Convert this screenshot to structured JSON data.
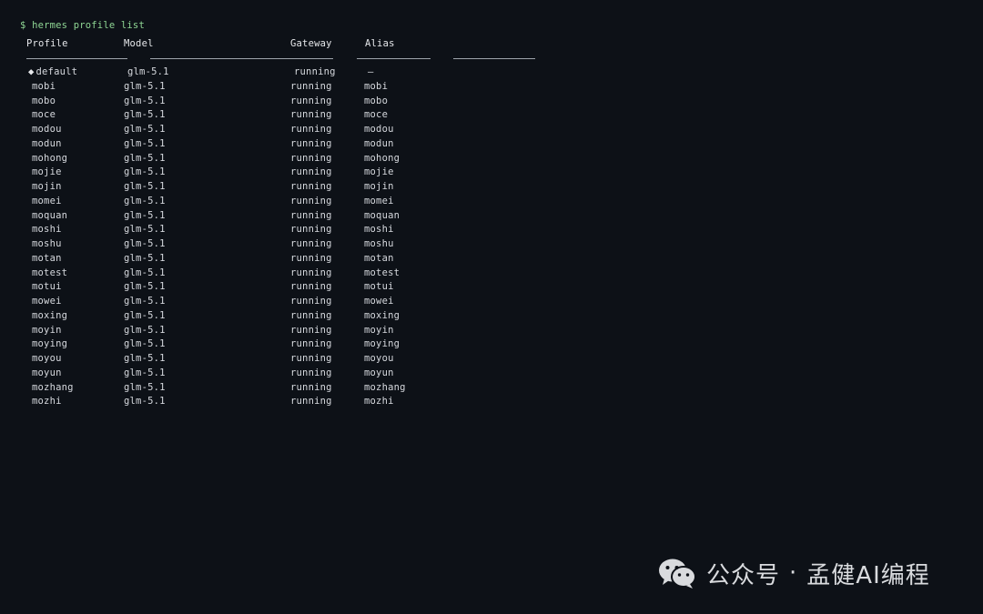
{
  "terminal": {
    "prompt": "$",
    "command": "hermes profile list",
    "columns": {
      "profile": "Profile",
      "model": "Model",
      "gateway": "Gateway",
      "alias": "Alias"
    },
    "default_marker": "◆",
    "rows": [
      {
        "profile": "default",
        "model": "glm-5.1",
        "gateway": "running",
        "alias": "—"
      },
      {
        "profile": "mobi",
        "model": "glm-5.1",
        "gateway": "running",
        "alias": "mobi"
      },
      {
        "profile": "mobo",
        "model": "glm-5.1",
        "gateway": "running",
        "alias": "mobo"
      },
      {
        "profile": "moce",
        "model": "glm-5.1",
        "gateway": "running",
        "alias": "moce"
      },
      {
        "profile": "modou",
        "model": "glm-5.1",
        "gateway": "running",
        "alias": "modou"
      },
      {
        "profile": "modun",
        "model": "glm-5.1",
        "gateway": "running",
        "alias": "modun"
      },
      {
        "profile": "mohong",
        "model": "glm-5.1",
        "gateway": "running",
        "alias": "mohong"
      },
      {
        "profile": "mojie",
        "model": "glm-5.1",
        "gateway": "running",
        "alias": "mojie"
      },
      {
        "profile": "mojin",
        "model": "glm-5.1",
        "gateway": "running",
        "alias": "mojin"
      },
      {
        "profile": "momei",
        "model": "glm-5.1",
        "gateway": "running",
        "alias": "momei"
      },
      {
        "profile": "moquan",
        "model": "glm-5.1",
        "gateway": "running",
        "alias": "moquan"
      },
      {
        "profile": "moshi",
        "model": "glm-5.1",
        "gateway": "running",
        "alias": "moshi"
      },
      {
        "profile": "moshu",
        "model": "glm-5.1",
        "gateway": "running",
        "alias": "moshu"
      },
      {
        "profile": "motan",
        "model": "glm-5.1",
        "gateway": "running",
        "alias": "motan"
      },
      {
        "profile": "motest",
        "model": "glm-5.1",
        "gateway": "running",
        "alias": "motest"
      },
      {
        "profile": "motui",
        "model": "glm-5.1",
        "gateway": "running",
        "alias": "motui"
      },
      {
        "profile": "mowei",
        "model": "glm-5.1",
        "gateway": "running",
        "alias": "mowei"
      },
      {
        "profile": "moxing",
        "model": "glm-5.1",
        "gateway": "running",
        "alias": "moxing"
      },
      {
        "profile": "moyin",
        "model": "glm-5.1",
        "gateway": "running",
        "alias": "moyin"
      },
      {
        "profile": "moying",
        "model": "glm-5.1",
        "gateway": "running",
        "alias": "moying"
      },
      {
        "profile": "moyou",
        "model": "glm-5.1",
        "gateway": "running",
        "alias": "moyou"
      },
      {
        "profile": "moyun",
        "model": "glm-5.1",
        "gateway": "running",
        "alias": "moyun"
      },
      {
        "profile": "mozhang",
        "model": "glm-5.1",
        "gateway": "running",
        "alias": "mozhang"
      },
      {
        "profile": "mozhi",
        "model": "glm-5.1",
        "gateway": "running",
        "alias": "mozhi"
      }
    ]
  },
  "watermark": {
    "icon": "wechat-icon",
    "text_left": "公众号",
    "separator": "·",
    "text_right": "孟健AI编程"
  },
  "colors": {
    "background": "#0d1117",
    "prompt": "#8fd694",
    "text": "#d6d9de"
  }
}
